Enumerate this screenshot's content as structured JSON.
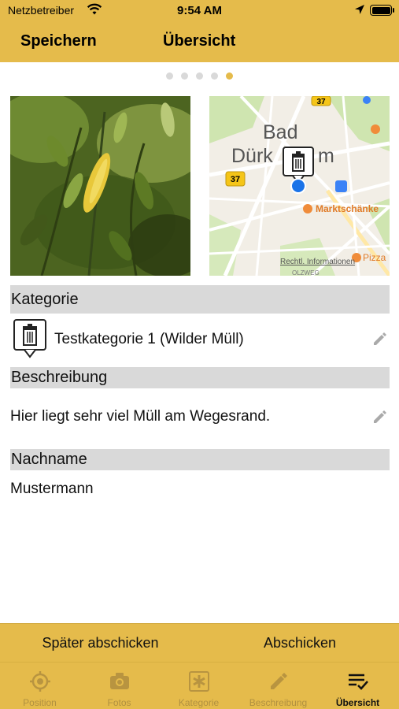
{
  "status_bar": {
    "carrier": "Netzbetreiber",
    "time": "9:54 AM"
  },
  "nav": {
    "save_label": "Speichern",
    "title": "Übersicht"
  },
  "page_indicator": {
    "count": 5,
    "active_index": 4
  },
  "map": {
    "city_label_line1": "Bad",
    "city_label_line2": "Dürk",
    "city_label_tail": "m",
    "road_37_top": "37",
    "road_37": "37",
    "poi_market": "Marktschänke",
    "poi_pizza": "Pizza",
    "legal": "Rechtl. Informationen",
    "street": "OLZWEG"
  },
  "sections": {
    "category_header": "Kategorie",
    "category_value": "Testkategorie 1 (Wilder Müll)",
    "description_header": "Beschreibung",
    "description_value": "Hier liegt sehr viel Müll am Wegesrand.",
    "lastname_header": "Nachname",
    "lastname_value": "Mustermann"
  },
  "actions": {
    "later_label": "Später abschicken",
    "send_label": "Abschicken"
  },
  "tabs": [
    {
      "label": "Position",
      "icon": "target-icon"
    },
    {
      "label": "Fotos",
      "icon": "camera-icon"
    },
    {
      "label": "Kategorie",
      "icon": "asterisk-icon"
    },
    {
      "label": "Beschreibung",
      "icon": "pencil-icon"
    },
    {
      "label": "Übersicht",
      "icon": "checklist-icon"
    }
  ],
  "colors": {
    "accent": "#e5bb4b",
    "section_bg": "#d9d9d9",
    "map_pin": "#1a73e8"
  }
}
